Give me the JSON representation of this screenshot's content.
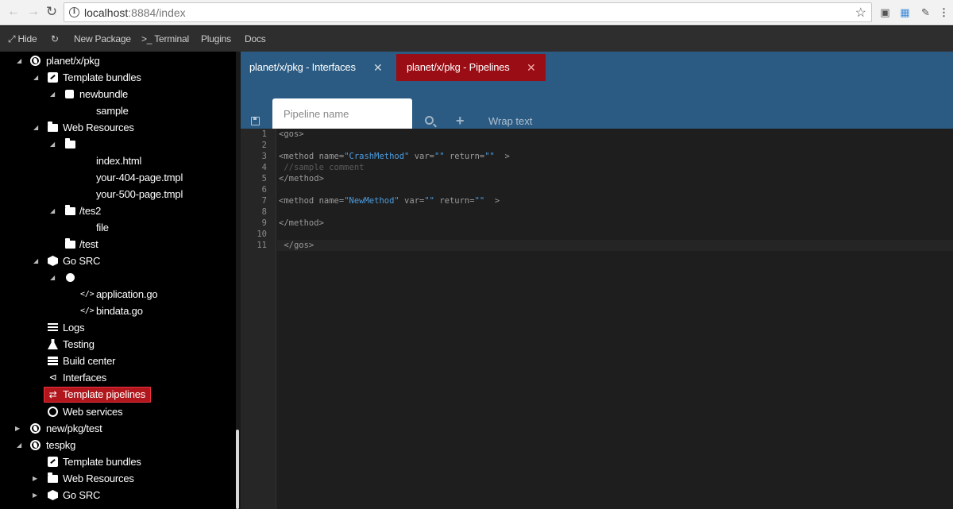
{
  "browser": {
    "url_host": "localhost",
    "url_rest": ":8884/index"
  },
  "toolbar": {
    "hide": "Hide",
    "new_package": "New Package",
    "terminal": ">_ Terminal",
    "plugins": "Plugins",
    "docs": "Docs"
  },
  "tree": [
    {
      "label": "planet/x/pkg",
      "icon": "globe-icon",
      "expanded": true
    },
    {
      "label": "Template bundles",
      "icon": "template-icon"
    },
    {
      "label": "newbundle",
      "icon": "bundle-icon"
    },
    {
      "label": "sample",
      "icon": ""
    },
    {
      "label": "Web Resources",
      "icon": "folder-icon"
    },
    {
      "label": "",
      "icon": "folder-icon"
    },
    {
      "label": "index.html",
      "icon": ""
    },
    {
      "label": "your-404-page.tmpl",
      "icon": ""
    },
    {
      "label": "your-500-page.tmpl",
      "icon": ""
    },
    {
      "label": "/tes2",
      "icon": "folder-icon"
    },
    {
      "label": "file",
      "icon": ""
    },
    {
      "label": "/test",
      "icon": "folder-icon"
    },
    {
      "label": "Go SRC",
      "icon": "cube-icon"
    },
    {
      "label": "",
      "icon": "circle-icon"
    },
    {
      "label": "application.go",
      "icon": "code-icon"
    },
    {
      "label": "bindata.go",
      "icon": "code-icon"
    },
    {
      "label": "Logs",
      "icon": "list-icon"
    },
    {
      "label": "Testing",
      "icon": "flask-icon"
    },
    {
      "label": "Build center",
      "icon": "server-icon"
    },
    {
      "label": "Interfaces",
      "icon": "share-icon"
    },
    {
      "label": "Template pipelines",
      "icon": "exchange-icon",
      "selected": true
    },
    {
      "label": "Web services",
      "icon": "ring-icon"
    },
    {
      "label": "new/pkg/test",
      "icon": "globe-icon"
    },
    {
      "label": "tespkg",
      "icon": "globe-icon"
    },
    {
      "label": "Template bundles",
      "icon": "template-icon"
    },
    {
      "label": "Web Resources",
      "icon": "folder-icon"
    },
    {
      "label": "Go SRC",
      "icon": "cube-icon"
    }
  ],
  "tabs": [
    {
      "label": "planet/x/pkg - Interfaces",
      "active": false
    },
    {
      "label": "planet/x/pkg - Pipelines",
      "active": true
    }
  ],
  "editor_toolbar": {
    "pipeline_placeholder": "Pipeline name",
    "wrap_text": "Wrap text"
  },
  "code": {
    "line_numbers": [
      "1",
      "2",
      "3",
      "4",
      "5",
      "6",
      "7",
      "8",
      "9",
      "10",
      "11"
    ],
    "l1": "<gos>",
    "l3_open": "<method name=",
    "l3_name": "\"CrashMethod\"",
    "l3_var": " var=",
    "l3_var_val": "\"\"",
    "l3_ret": " return=",
    "l3_ret_val": "\"\"",
    "l3_close": "  >",
    "l4": " //sample comment",
    "l5": "</method>",
    "l7_open": "<method name=",
    "l7_name": "\"NewMethod\"",
    "l7_var": " var=",
    "l7_var_val": "\"\"",
    "l7_ret": " return=",
    "l7_ret_val": "\"\"",
    "l7_close": "  >",
    "l9": "</method>",
    "l11": " </gos>"
  },
  "colors": {
    "tab_bar": "#2b5b82",
    "active_tab": "#9b0d14",
    "selected_item": "#b0161b",
    "string": "#4d9de0"
  }
}
